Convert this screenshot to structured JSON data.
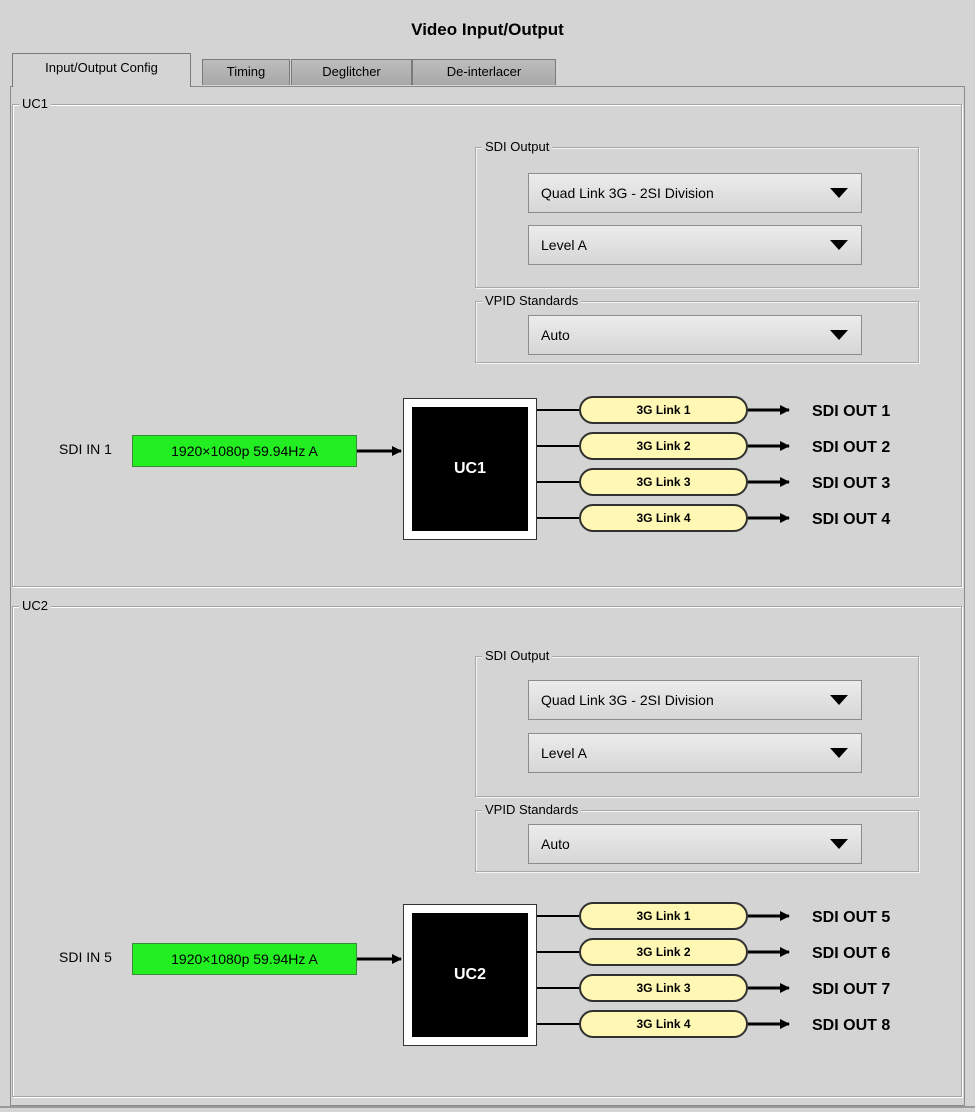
{
  "window_title": "Video Input/Output",
  "tabs": [
    {
      "label": "Input/Output Config",
      "active": true
    },
    {
      "label": "Timing",
      "active": false
    },
    {
      "label": "Deglitcher",
      "active": false
    },
    {
      "label": "De-interlacer",
      "active": false
    }
  ],
  "uc1": {
    "group_label": "UC1",
    "sdi_output_legend": "SDI Output",
    "sdi_output_mode": "Quad Link 3G - 2SI Division",
    "sdi_output_level": "Level A",
    "vpid_legend": "VPID Standards",
    "vpid_value": "Auto",
    "input_label": "SDI IN 1",
    "input_status": "1920×1080p 59.94Hz A",
    "block_label": "UC1",
    "links": [
      "3G Link 1",
      "3G Link 2",
      "3G Link 3",
      "3G Link 4"
    ],
    "outputs": [
      "SDI OUT 1",
      "SDI OUT 2",
      "SDI OUT 3",
      "SDI OUT 4"
    ]
  },
  "uc2": {
    "group_label": "UC2",
    "sdi_output_legend": "SDI Output",
    "sdi_output_mode": "Quad Link 3G - 2SI Division",
    "sdi_output_level": "Level A",
    "vpid_legend": "VPID Standards",
    "vpid_value": "Auto",
    "input_label": "SDI IN 5",
    "input_status": "1920×1080p 59.94Hz A",
    "block_label": "UC2",
    "links": [
      "3G Link 1",
      "3G Link 2",
      "3G Link 3",
      "3G Link 4"
    ],
    "outputs": [
      "SDI OUT 5",
      "SDI OUT 6",
      "SDI OUT 7",
      "SDI OUT 8"
    ]
  },
  "colors": {
    "input_ok": "#22ee22",
    "link_fill": "#fff8b4",
    "panel_bg": "#d4d4d4"
  },
  "icons": {
    "dropdown": "caret-down-icon",
    "arrow": "arrow-right-icon"
  }
}
